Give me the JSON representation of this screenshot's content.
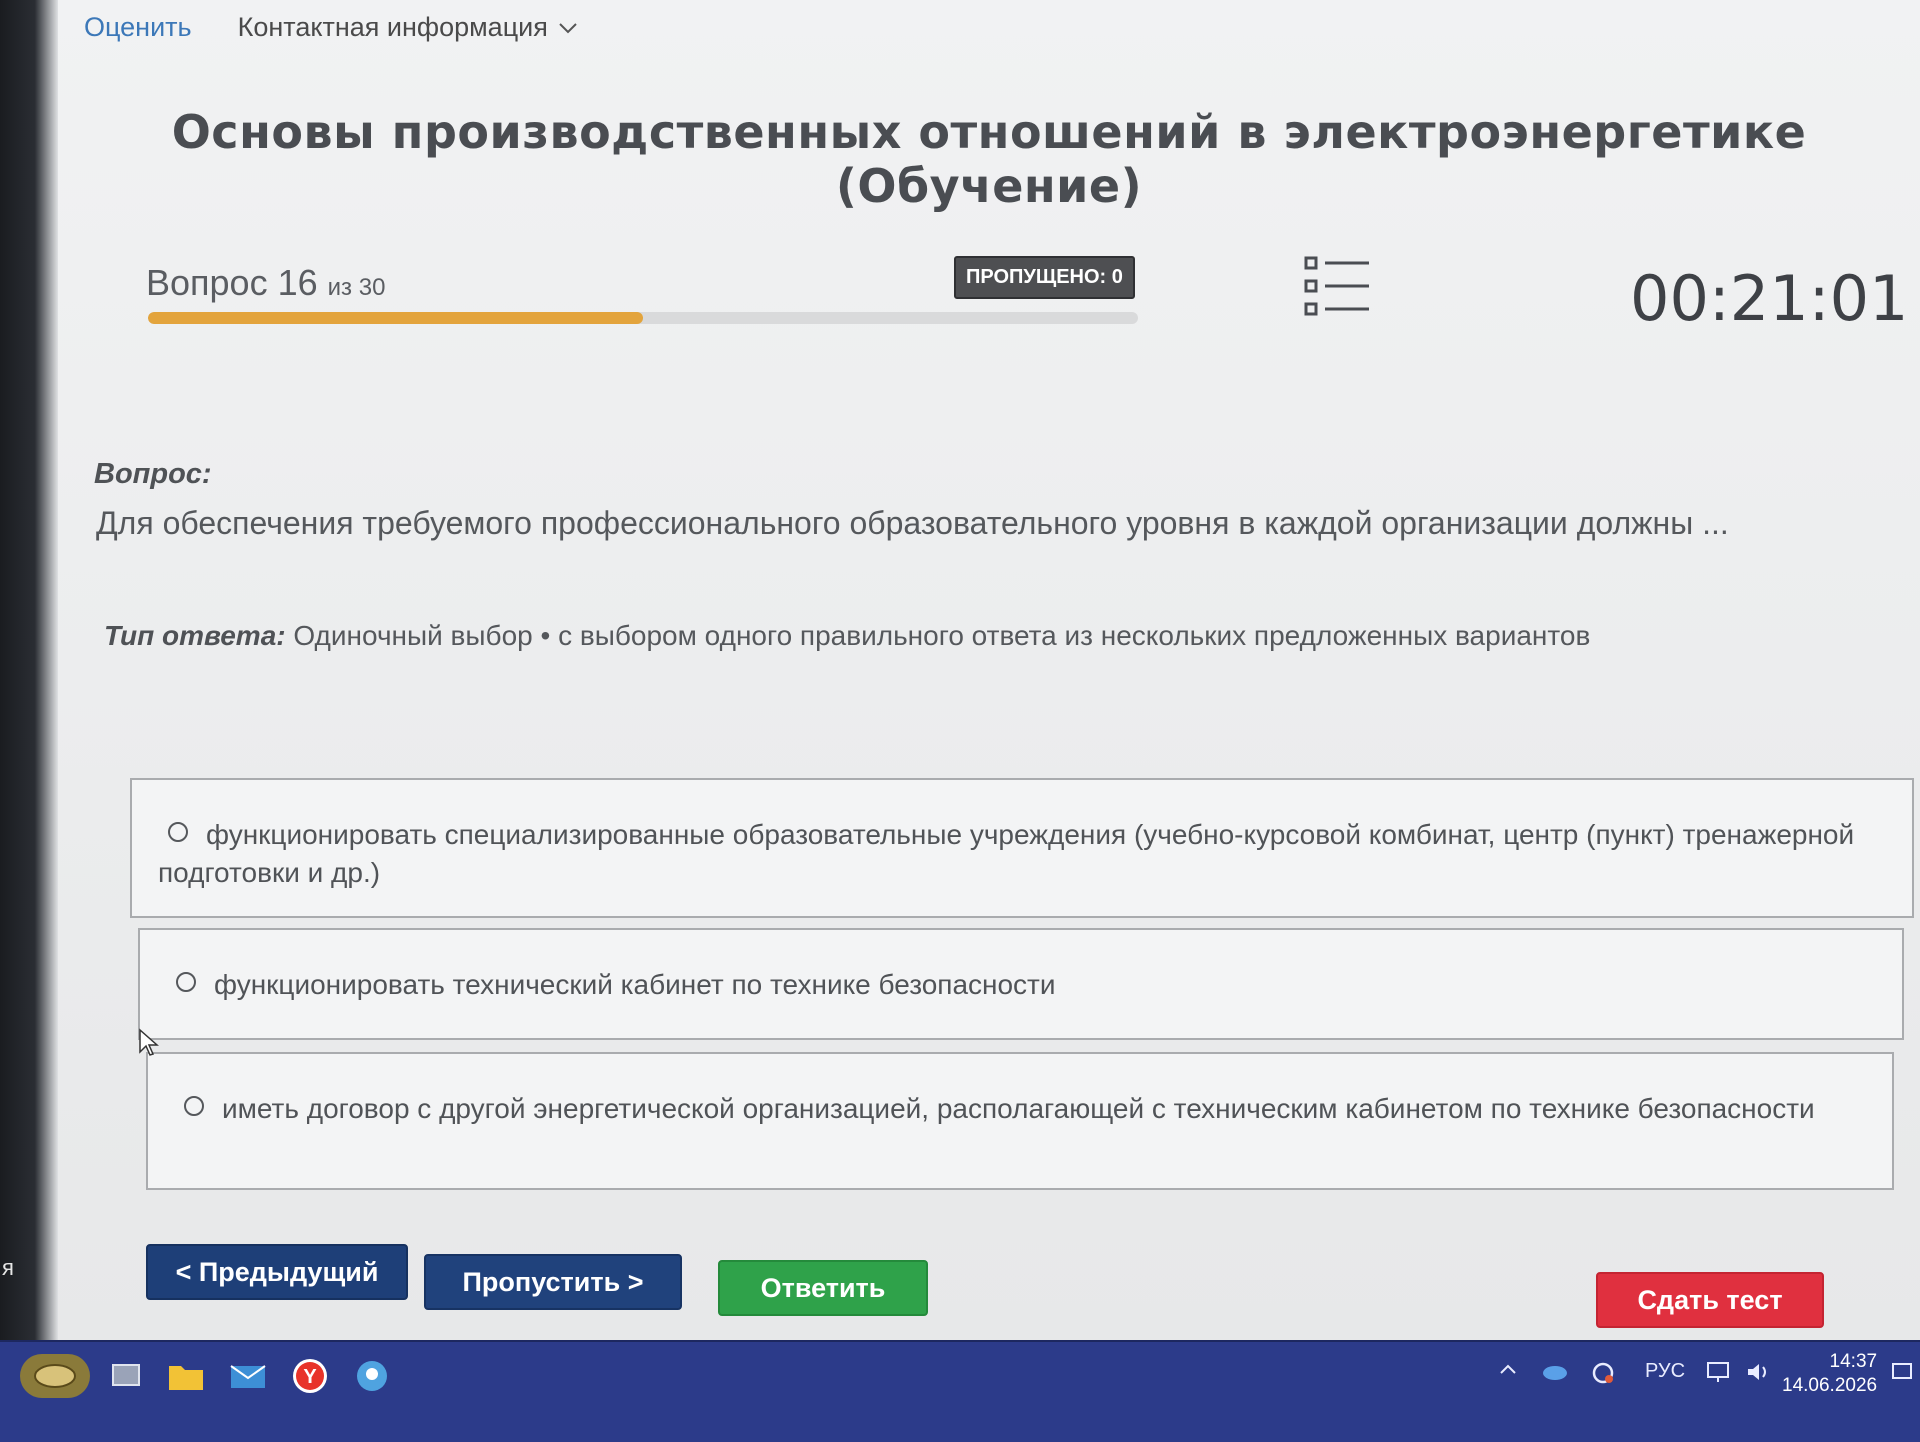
{
  "nav": {
    "rate_link": "Оценить",
    "contact_label": "Контактная информация"
  },
  "title": "Основы производственных отношений в электроэнергетике (Обучение)",
  "progress": {
    "question_prefix": "Вопрос 16",
    "question_suffix": "из 30",
    "current": 16,
    "total": 30,
    "fill_fraction": 0.5,
    "skipped_badge": "ПРОПУЩЕНО: 0",
    "timer": "00:21:01"
  },
  "question": {
    "label": "Вопрос:",
    "text": "Для обеспечения требуемого профессионального образовательного уровня в каждой организации должны ..."
  },
  "answer_type": {
    "label": "Тип ответа:",
    "value": "Одиночный выбор • с выбором одного правильного ответа из нескольких предложенных вариантов"
  },
  "options": [
    {
      "text": "функционировать специализированные образовательные учреждения (учебно-курсовой комбинат, центр (пункт) тренажерной подготовки и др.)"
    },
    {
      "text": "функционировать технический кабинет по технике безопасности"
    },
    {
      "text": "иметь договор с другой энергетической организацией, располагающей с техническим кабинетом по технике безопасности"
    }
  ],
  "buttons": {
    "previous": "< Предыдущий",
    "skip": "Пропустить >",
    "answer": "Ответить",
    "submit": "Сдать тест"
  },
  "colors": {
    "progress_fill": "#e3a43c",
    "nav_button": "#1e3f78",
    "answer_button": "#2fa24a",
    "submit_button": "#e0303f",
    "taskbar": "#2c3b8a"
  },
  "taskbar": {
    "language": "РУС",
    "time": "14:37",
    "date": "14.06.2026"
  },
  "sidebar_fragment": "я"
}
